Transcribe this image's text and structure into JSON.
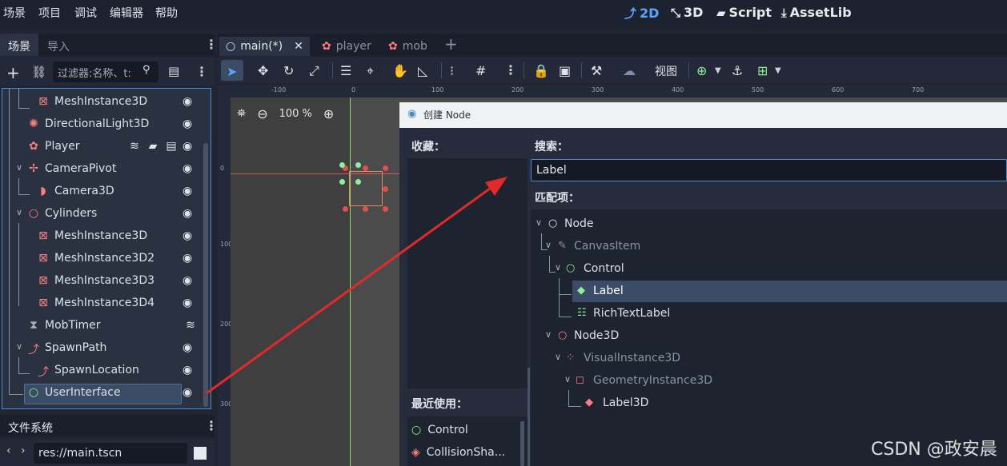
{
  "menu": {
    "items": [
      "场景",
      "项目",
      "调试",
      "编辑器",
      "帮助"
    ]
  },
  "workspaces": [
    {
      "label": "2D",
      "icon": "2d-icon",
      "active": true
    },
    {
      "label": "3D",
      "icon": "3d-icon",
      "active": false
    },
    {
      "label": "Script",
      "icon": "script-icon",
      "active": false
    },
    {
      "label": "AssetLib",
      "icon": "assetlib-icon",
      "active": false
    }
  ],
  "dock": {
    "tab_scene": "场景",
    "tab_import": "导入",
    "filter_placeholder": "过滤器:名称、t:"
  },
  "scene_tree": [
    {
      "label": "MeshInstance3D",
      "icon": "mesh-icon"
    },
    {
      "label": "DirectionalLight3D",
      "icon": "light-icon"
    },
    {
      "label": "Player",
      "icon": "player-icon"
    },
    {
      "label": "CameraPivot",
      "icon": "node3d-icon"
    },
    {
      "label": "Camera3D",
      "icon": "camera-icon"
    },
    {
      "label": "Cylinders",
      "icon": "node3d-icon"
    },
    {
      "label": "MeshInstance3D",
      "icon": "mesh-icon"
    },
    {
      "label": "MeshInstance3D2",
      "icon": "mesh-icon"
    },
    {
      "label": "MeshInstance3D3",
      "icon": "mesh-icon"
    },
    {
      "label": "MeshInstance3D4",
      "icon": "mesh-icon"
    },
    {
      "label": "MobTimer",
      "icon": "timer-icon"
    },
    {
      "label": "SpawnPath",
      "icon": "path-icon"
    },
    {
      "label": "SpawnLocation",
      "icon": "pathfollow-icon"
    },
    {
      "label": "UserInterface",
      "icon": "control-icon"
    }
  ],
  "filesystem": {
    "tab": "文件系统",
    "path": "res://main.tscn"
  },
  "editor_tabs": [
    {
      "label": "main(*)",
      "active": true
    },
    {
      "label": "player",
      "active": false
    },
    {
      "label": "mob",
      "active": false
    }
  ],
  "toolbar": {
    "view_label": "视图"
  },
  "viewport": {
    "zoom": "100 %"
  },
  "ruler": {
    "top": [
      "-100",
      "0",
      "100",
      "200",
      "300",
      "400",
      "500",
      "600",
      "700"
    ],
    "left": [
      "0",
      "100",
      "200",
      "300"
    ]
  },
  "dialog": {
    "title": "创建 Node",
    "favorites_label": "收藏：",
    "recent_label": "最近使用：",
    "search_label": "搜索：",
    "search_value": "Label",
    "matches_label": "匹配项：",
    "matches": [
      {
        "label": "Node",
        "dim": false
      },
      {
        "label": "CanvasItem",
        "dim": true
      },
      {
        "label": "Control",
        "dim": false
      },
      {
        "label": "Label",
        "dim": false
      },
      {
        "label": "RichTextLabel",
        "dim": false
      },
      {
        "label": "Node3D",
        "dim": false
      },
      {
        "label": "VisualInstance3D",
        "dim": true
      },
      {
        "label": "GeometryInstance3D",
        "dim": true
      },
      {
        "label": "Label3D",
        "dim": false
      }
    ],
    "recent": [
      {
        "label": "Control"
      },
      {
        "label": "CollisionSha..."
      }
    ]
  },
  "watermark": "CSDN @政安晨",
  "colors": {
    "accent": "#57a6ff",
    "node3d": "#fc7f7f",
    "control": "#8eef97",
    "selection": "#3b4c66"
  }
}
